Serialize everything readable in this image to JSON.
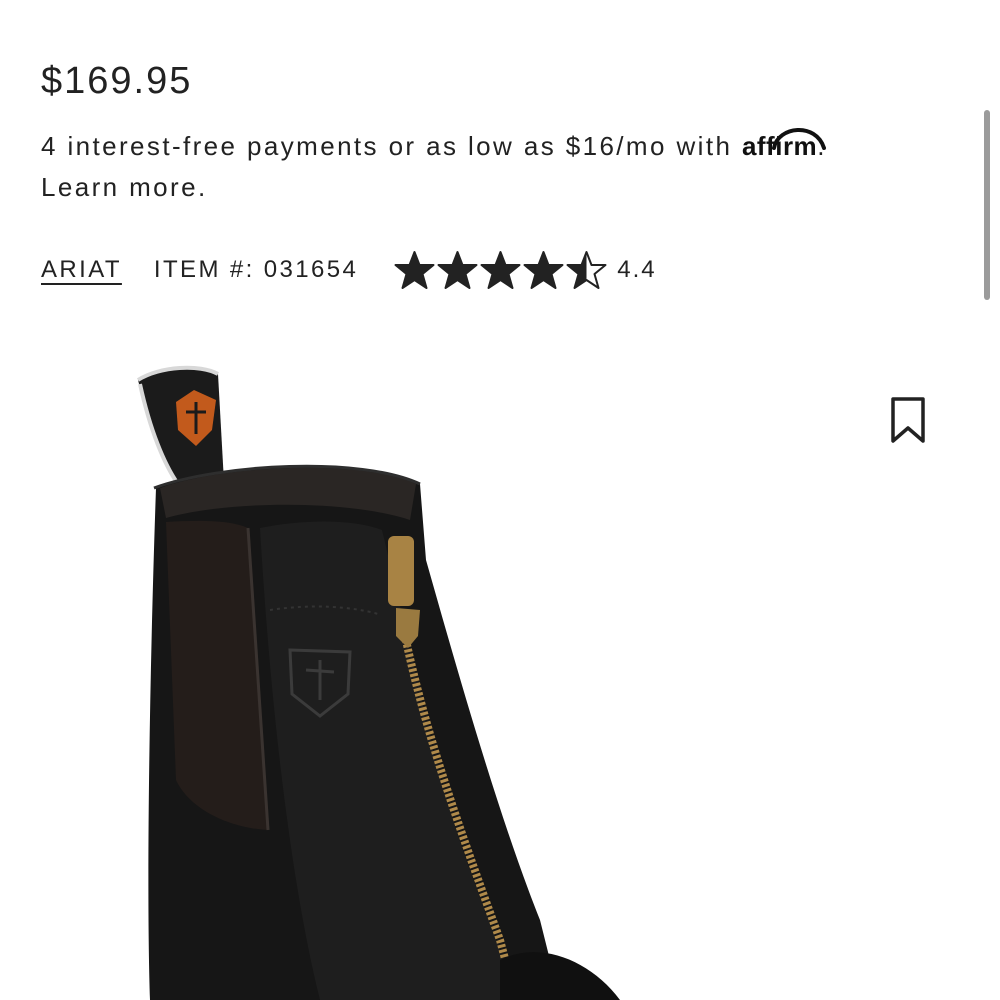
{
  "product": {
    "price": "$169.95",
    "payments_text": "4 interest-free payments or as low as $16/mo with",
    "payments_logo": "affirm",
    "payments_period": ".",
    "learn_more": "Learn more.",
    "brand": "ARIAT",
    "item_number": "ITEM #: 031654",
    "rating": 4.4,
    "rating_label": "4.4",
    "rating_max": 5
  },
  "icons": {
    "bookmark": "bookmark-icon",
    "star": "star-icon"
  },
  "colors": {
    "text": "#222222",
    "background": "#ffffff",
    "scrollbar": "#8a8a8a",
    "logo_orange": "#c25a1c"
  }
}
